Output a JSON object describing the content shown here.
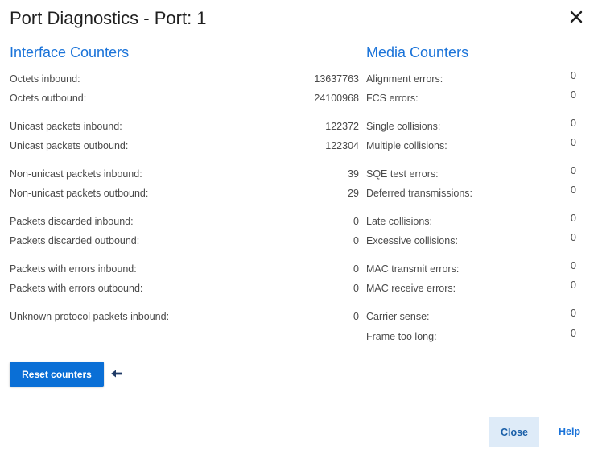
{
  "dialog": {
    "title": "Port Diagnostics - Port: 1",
    "close_icon": "close-icon"
  },
  "interface": {
    "heading": "Interface Counters",
    "rows": [
      {
        "label": "Octets inbound:",
        "value": "13637763"
      },
      {
        "label": "Octets outbound:",
        "value": "24100968"
      },
      {
        "label": "Unicast packets inbound:",
        "value": "122372"
      },
      {
        "label": "Unicast packets outbound:",
        "value": "122304"
      },
      {
        "label": "Non-unicast packets inbound:",
        "value": "39"
      },
      {
        "label": "Non-unicast packets outbound:",
        "value": "29"
      },
      {
        "label": "Packets discarded inbound:",
        "value": "0"
      },
      {
        "label": "Packets discarded outbound:",
        "value": "0"
      },
      {
        "label": "Packets with errors inbound:",
        "value": "0"
      },
      {
        "label": "Packets with errors outbound:",
        "value": "0"
      },
      {
        "label": "Unknown protocol packets inbound:",
        "value": "0"
      }
    ]
  },
  "media": {
    "heading": "Media Counters",
    "rows": [
      {
        "label": "Alignment errors:",
        "value": "0"
      },
      {
        "label": "FCS errors:",
        "value": "0"
      },
      {
        "label": "Single collisions:",
        "value": "0"
      },
      {
        "label": "Multiple collisions:",
        "value": "0"
      },
      {
        "label": "SQE test errors:",
        "value": "0"
      },
      {
        "label": "Deferred transmissions:",
        "value": "0"
      },
      {
        "label": "Late collisions:",
        "value": "0"
      },
      {
        "label": "Excessive collisions:",
        "value": "0"
      },
      {
        "label": "MAC transmit errors:",
        "value": "0"
      },
      {
        "label": "MAC receive errors:",
        "value": "0"
      },
      {
        "label": "Carrier sense:",
        "value": "0"
      },
      {
        "label": "Frame too long:",
        "value": "0"
      }
    ]
  },
  "actions": {
    "reset_label": "Reset counters",
    "reset_hint_icon": "arrow-left-icon",
    "close_label": "Close",
    "help_label": "Help"
  },
  "colors": {
    "accent": "#1a73d9",
    "primary_button": "#0a6fd6",
    "secondary_button_bg": "#deebf8"
  }
}
